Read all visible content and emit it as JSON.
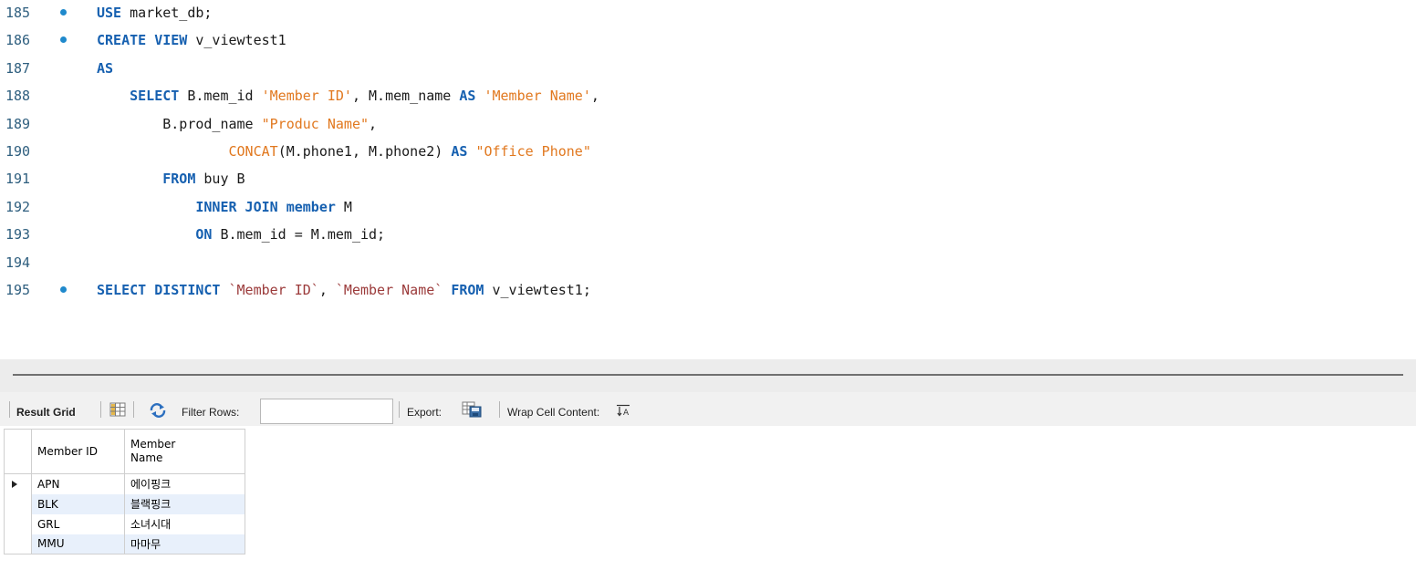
{
  "editor": {
    "lines": [
      {
        "num": "185",
        "dot": true,
        "tokens": [
          {
            "t": "USE",
            "c": "kw"
          },
          {
            "t": " market_db;",
            "c": ""
          }
        ]
      },
      {
        "num": "186",
        "dot": true,
        "tokens": [
          {
            "t": "CREATE VIEW",
            "c": "kw"
          },
          {
            "t": " v_viewtest1",
            "c": ""
          }
        ]
      },
      {
        "num": "187",
        "dot": false,
        "tokens": [
          {
            "t": "AS",
            "c": "kw"
          }
        ]
      },
      {
        "num": "188",
        "dot": false,
        "tokens": [
          {
            "t": "    ",
            "c": ""
          },
          {
            "t": "SELECT",
            "c": "kw"
          },
          {
            "t": " B.mem_id ",
            "c": ""
          },
          {
            "t": "'Member ID'",
            "c": "str"
          },
          {
            "t": ", M.mem_name ",
            "c": ""
          },
          {
            "t": "AS",
            "c": "kw"
          },
          {
            "t": " ",
            "c": ""
          },
          {
            "t": "'Member Name'",
            "c": "str"
          },
          {
            "t": ",",
            "c": ""
          }
        ]
      },
      {
        "num": "189",
        "dot": false,
        "tokens": [
          {
            "t": "        B.prod_name ",
            "c": ""
          },
          {
            "t": "\"Produc Name\"",
            "c": "str"
          },
          {
            "t": ",",
            "c": ""
          }
        ]
      },
      {
        "num": "190",
        "dot": false,
        "tokens": [
          {
            "t": "                ",
            "c": ""
          },
          {
            "t": "CONCAT",
            "c": "fn"
          },
          {
            "t": "(M.phone1, M.phone2) ",
            "c": ""
          },
          {
            "t": "AS",
            "c": "kw"
          },
          {
            "t": " ",
            "c": ""
          },
          {
            "t": "\"Office Phone\"",
            "c": "str"
          }
        ]
      },
      {
        "num": "191",
        "dot": false,
        "tokens": [
          {
            "t": "        ",
            "c": ""
          },
          {
            "t": "FROM",
            "c": "kw"
          },
          {
            "t": " buy B",
            "c": ""
          }
        ]
      },
      {
        "num": "192",
        "dot": false,
        "tokens": [
          {
            "t": "            ",
            "c": ""
          },
          {
            "t": "INNER JOIN",
            "c": "kw"
          },
          {
            "t": " ",
            "c": ""
          },
          {
            "t": "member",
            "c": "kw"
          },
          {
            "t": " M",
            "c": ""
          }
        ]
      },
      {
        "num": "193",
        "dot": false,
        "tokens": [
          {
            "t": "            ",
            "c": ""
          },
          {
            "t": "ON",
            "c": "kw"
          },
          {
            "t": " B.mem_id = M.mem_id;",
            "c": ""
          }
        ]
      },
      {
        "num": "194",
        "dot": false,
        "tokens": []
      },
      {
        "num": "195",
        "dot": true,
        "tokens": [
          {
            "t": "SELECT DISTINCT",
            "c": "kw"
          },
          {
            "t": " ",
            "c": ""
          },
          {
            "t": "`Member ID`",
            "c": "bt"
          },
          {
            "t": ", ",
            "c": ""
          },
          {
            "t": "`Member Name`",
            "c": "bt"
          },
          {
            "t": " ",
            "c": ""
          },
          {
            "t": "FROM",
            "c": "kw"
          },
          {
            "t": " v_viewtest1;",
            "c": ""
          }
        ]
      }
    ]
  },
  "toolbar": {
    "result_grid_label": "Result Grid",
    "filter_rows_label": "Filter Rows:",
    "filter_rows_value": "",
    "export_label": "Export:",
    "wrap_cell_label": "Wrap Cell Content:"
  },
  "grid": {
    "columns": [
      "Member ID",
      "Member",
      "Name"
    ],
    "rows": [
      {
        "id": "APN",
        "name": "에이핑크",
        "selected": true
      },
      {
        "id": "BLK",
        "name": "블랙핑크",
        "selected": false
      },
      {
        "id": "GRL",
        "name": "소녀시대",
        "selected": false
      },
      {
        "id": "MMU",
        "name": "마마무",
        "selected": false
      }
    ]
  },
  "colors": {
    "keyword": "#1660b0",
    "string": "#e1781f",
    "backtick_identifier": "#9b3a3a",
    "line_number": "#2f5f7f",
    "statement_dot": "#1f89cc",
    "alt_row": "#e8f0fb"
  }
}
